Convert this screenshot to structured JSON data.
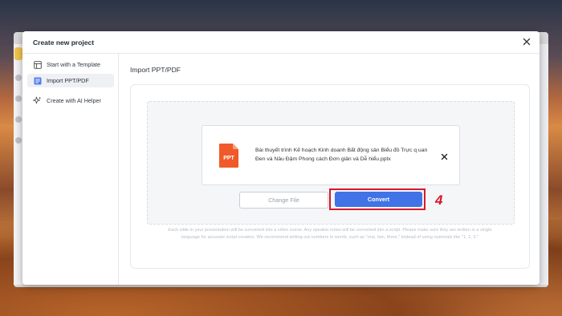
{
  "modal": {
    "title": "Create new project",
    "close_icon": "close-icon"
  },
  "sidebar": {
    "items": [
      {
        "label": "Start with a Template",
        "icon": "template-icon",
        "active": false
      },
      {
        "label": "Import PPT/PDF",
        "icon": "import-ppt-icon",
        "active": true
      },
      {
        "label": "Create with AI Helper",
        "icon": "ai-sparkle-icon",
        "active": false
      }
    ]
  },
  "main": {
    "section_title": "Import PPT/PDF",
    "file": {
      "icon_text": "PPT",
      "name": "Bài thuyết trình Kế hoạch Kinh doanh Bất động sản Biểu đồ Trực q uan Đen và Nâu Đậm Phong cách Đơn giản và Dễ hiểu.pptx"
    },
    "buttons": {
      "change_file": "Change File",
      "convert": "Convert"
    },
    "annotation_step": "4",
    "helper_text": "Each slide in your presentation will be converted into a video scene. Any speaker notes will be converted into a script. Please make sure they are written in a single language for accurate script creation. We recommend writing out numbers in words, such as \"one, two, three,\" instead of using numerals like \"1, 2, 3.\""
  },
  "colors": {
    "accent": "#3f73e6",
    "ppt_icon": "#f0592a",
    "annotation": "#d7192a"
  }
}
